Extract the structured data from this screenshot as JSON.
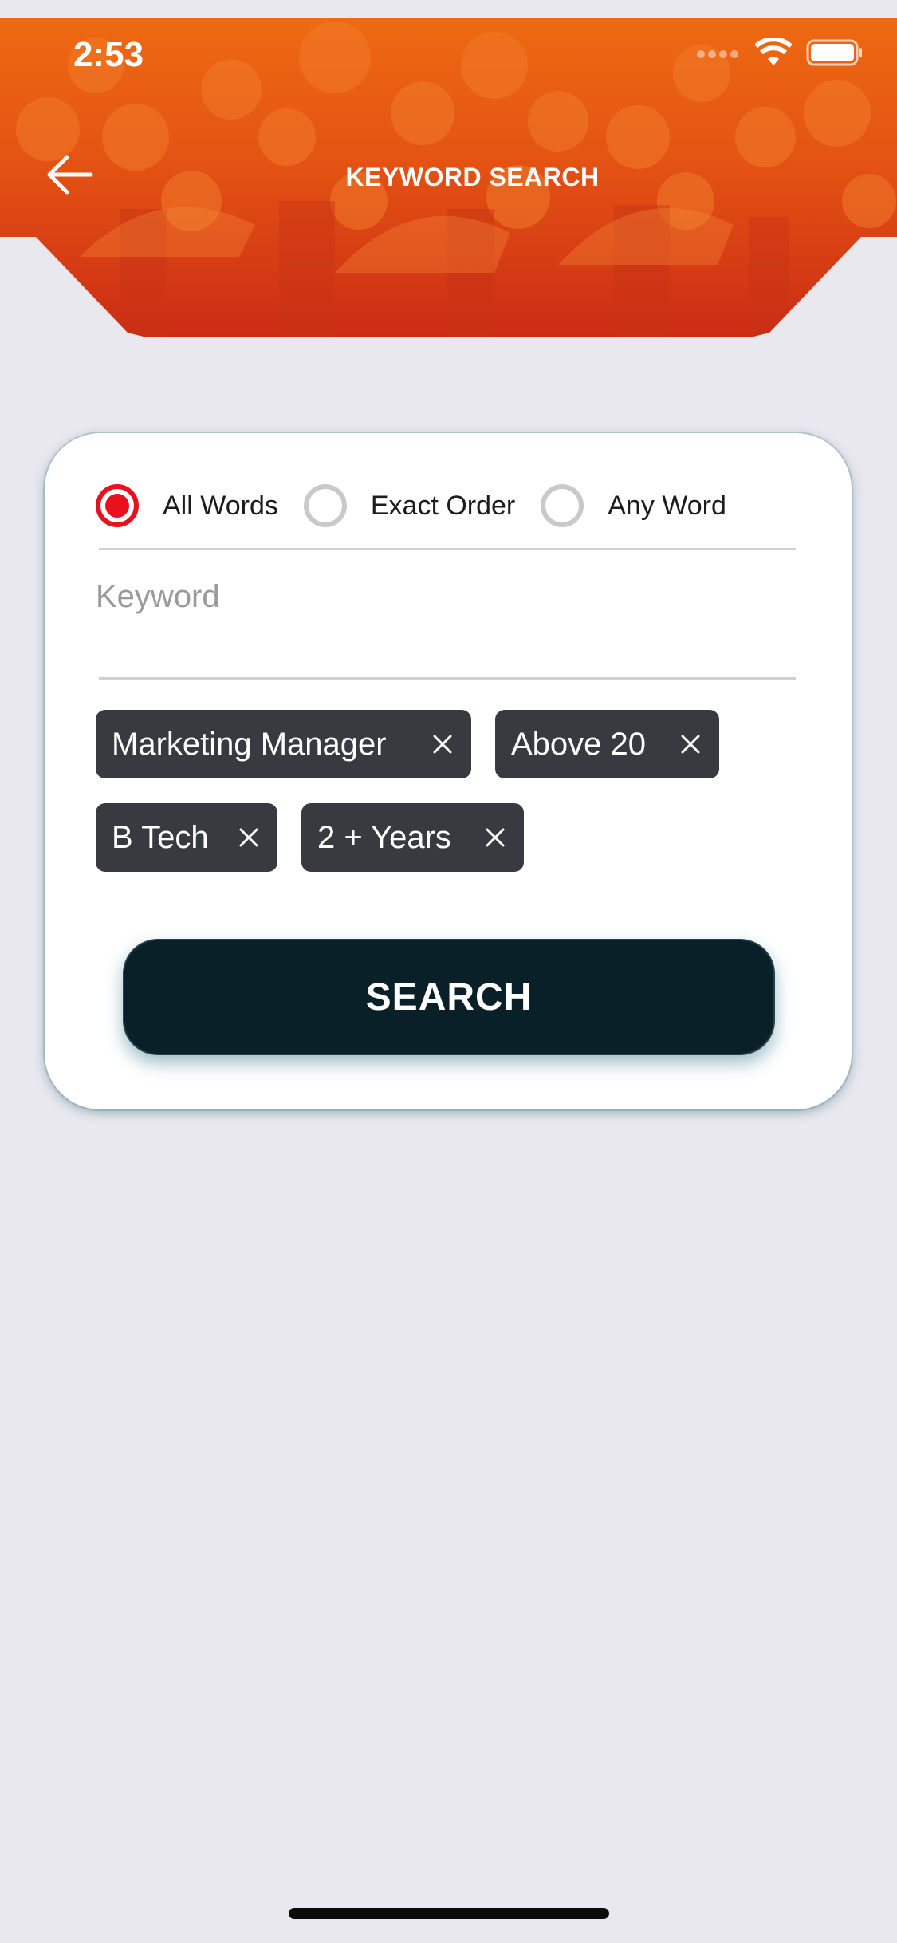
{
  "status_bar": {
    "time": "2:53"
  },
  "header": {
    "title": "KEYWORD SEARCH"
  },
  "match_mode": {
    "options": [
      "All Words",
      "Exact Order",
      "Any Word"
    ],
    "selected": "All Words"
  },
  "keyword": {
    "value": "",
    "placeholder": "Keyword"
  },
  "chips": [
    "Marketing Manager",
    "Above 20",
    "B Tech",
    "2 + Years"
  ],
  "search_button": {
    "label": "SEARCH"
  },
  "colors": {
    "header_top": "#ee6a12",
    "header_bottom": "#cc2c14",
    "accent_red": "#e8121f",
    "chip_bg": "#373a3f",
    "button_bg": "#0a2028",
    "page_bg": "#e9e8ef"
  },
  "icons": [
    "back-arrow-icon",
    "cellular-signal-icon",
    "wifi-icon",
    "battery-icon",
    "remove-chip-icon"
  ]
}
